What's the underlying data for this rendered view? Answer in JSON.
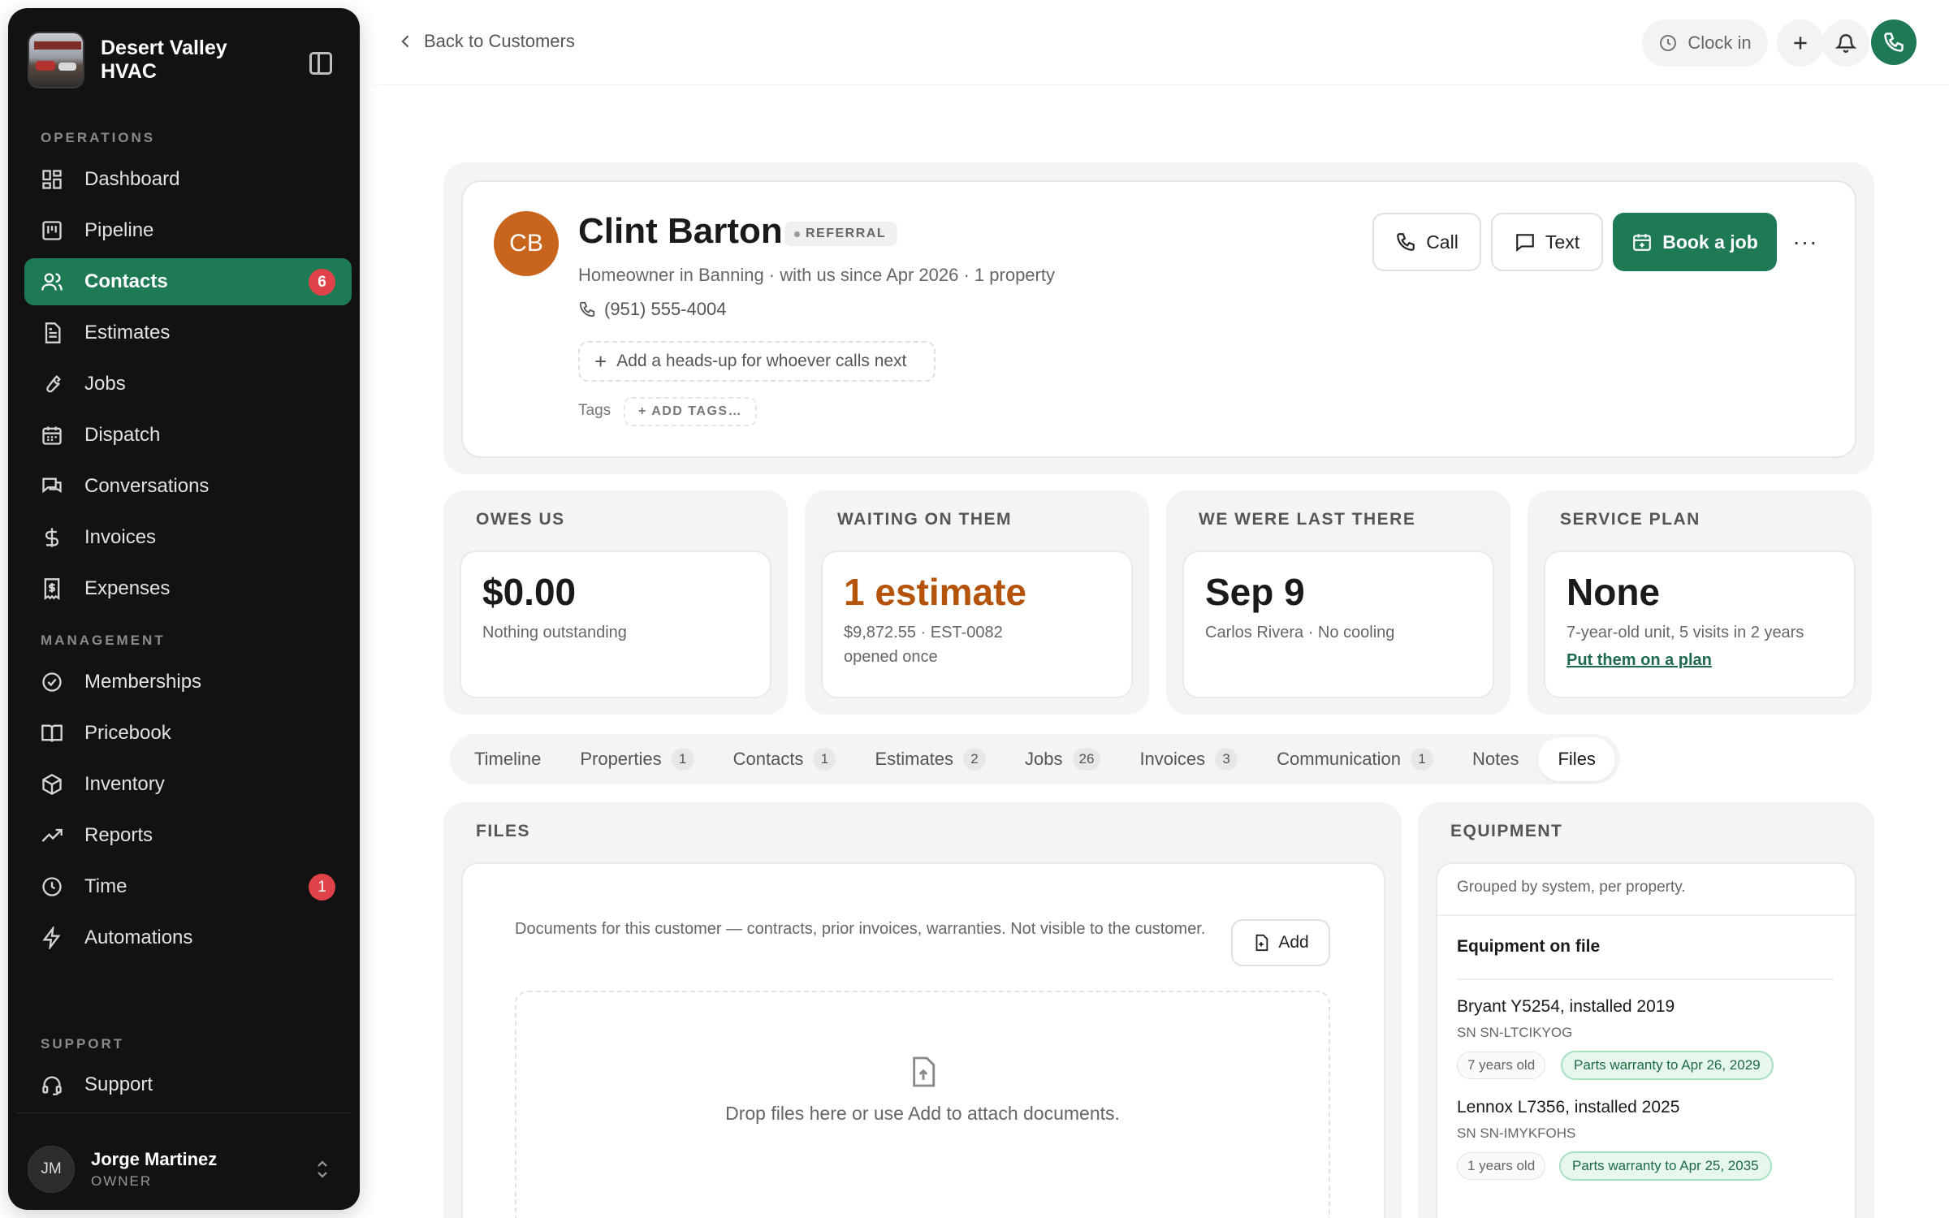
{
  "sidebar": {
    "brand_name": "Desert Valley HVAC",
    "sections": {
      "operations": "OPERATIONS",
      "management": "MANAGEMENT",
      "support": "SUPPORT"
    },
    "items": [
      {
        "label": "Dashboard",
        "icon": "dashboard-icon"
      },
      {
        "label": "Pipeline",
        "icon": "pipeline-icon"
      },
      {
        "label": "Contacts",
        "icon": "contacts-icon",
        "badge": "6",
        "active": true
      },
      {
        "label": "Estimates",
        "icon": "estimates-icon"
      },
      {
        "label": "Jobs",
        "icon": "wrench-icon"
      },
      {
        "label": "Dispatch",
        "icon": "calendar-icon"
      },
      {
        "label": "Conversations",
        "icon": "chat-icon"
      },
      {
        "label": "Invoices",
        "icon": "dollar-icon"
      },
      {
        "label": "Expenses",
        "icon": "receipt-icon"
      },
      {
        "label": "Memberships",
        "icon": "badge-check-icon"
      },
      {
        "label": "Pricebook",
        "icon": "book-icon"
      },
      {
        "label": "Inventory",
        "icon": "box-icon"
      },
      {
        "label": "Reports",
        "icon": "trend-icon"
      },
      {
        "label": "Time",
        "icon": "clock-icon",
        "badge": "1"
      },
      {
        "label": "Automations",
        "icon": "bolt-icon"
      },
      {
        "label": "Support",
        "icon": "headset-icon"
      }
    ],
    "user": {
      "initials": "JM",
      "name": "Jorge Martinez",
      "role": "OWNER"
    }
  },
  "topbar": {
    "back_label": "Back to Customers",
    "clock_in_label": "Clock in"
  },
  "customer": {
    "initials": "CB",
    "name": "Clint Barton",
    "tag": "REFERRAL",
    "subtitle": "Homeowner in Banning · with us since Apr 2026 · 1 property",
    "phone": "(951) 555-4004",
    "headsup_placeholder": "Add a heads-up for whoever calls next",
    "tags_label": "Tags",
    "add_tags_label": "+ ADD TAGS…",
    "actions": {
      "call": "Call",
      "text": "Text",
      "book": "Book a job",
      "more": "···"
    },
    "avatar_color": "#c8641c"
  },
  "stats": [
    {
      "label": "OWES US",
      "value": "$0.00",
      "note": "Nothing outstanding"
    },
    {
      "label": "WAITING ON THEM",
      "value": "1 estimate",
      "note": "$9,872.55 · EST-0082",
      "note2": "opened once"
    },
    {
      "label": "WE WERE LAST THERE",
      "value": "Sep 9",
      "note": "Carlos Rivera · No cooling"
    },
    {
      "label": "SERVICE PLAN",
      "value": "None",
      "note": "7-year-old unit, 5 visits in 2 years",
      "link": "Put them on a plan"
    }
  ],
  "tabs": [
    {
      "label": "Timeline"
    },
    {
      "label": "Properties",
      "count": "1"
    },
    {
      "label": "Contacts",
      "count": "1"
    },
    {
      "label": "Estimates",
      "count": "2"
    },
    {
      "label": "Jobs",
      "count": "26"
    },
    {
      "label": "Invoices",
      "count": "3"
    },
    {
      "label": "Communication",
      "count": "1"
    },
    {
      "label": "Notes"
    },
    {
      "label": "Files",
      "active": true
    }
  ],
  "files": {
    "title": "FILES",
    "description": "Documents for this customer — contracts, prior invoices, warranties. Not visible to the customer.",
    "add_label": "Add",
    "drop_text": "Drop files here or use Add to attach documents."
  },
  "equipment": {
    "title": "EQUIPMENT",
    "subtitle": "Grouped by system, per property.",
    "section_title": "Equipment on file",
    "items": [
      {
        "name": "Bryant Y5254, installed 2019",
        "sn": "SN SN-LTCIKYOG",
        "age": "7 years old",
        "warranty": "Parts warranty to Apr 26, 2029"
      },
      {
        "name": "Lennox L7356, installed 2025",
        "sn": "SN SN-IMYKFOHS",
        "age": "1 years old",
        "warranty": "Parts warranty to Apr 25, 2035"
      }
    ]
  },
  "colors": {
    "brand_green": "#1e7a55",
    "badge_red": "#e0424a",
    "estimate_orange": "#b45309"
  }
}
